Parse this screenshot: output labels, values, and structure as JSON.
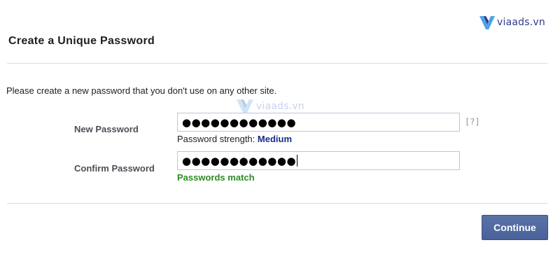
{
  "logo": {
    "text": "viaads.vn",
    "icon": "viaads-v-icon",
    "color": "#2e3a8c"
  },
  "watermark": {
    "text": "viaads.vn",
    "icon": "viaads-v-icon"
  },
  "dialog": {
    "title": "Create a Unique Password",
    "instruction": "Please create a new password that you don't use on any other site.",
    "new_password": {
      "label": "New Password",
      "value": "●●●●●●●●●●●●",
      "help": "[?]"
    },
    "strength": {
      "prefix": "Password strength:",
      "value": "Medium",
      "color": "#1a2a8a"
    },
    "confirm_password": {
      "label": "Confirm Password",
      "value": "●●●●●●●●●●●●"
    },
    "match_message": "Passwords match",
    "match_color": "#2e8b22",
    "continue_label": "Continue",
    "button_color": "#4e66a0"
  }
}
